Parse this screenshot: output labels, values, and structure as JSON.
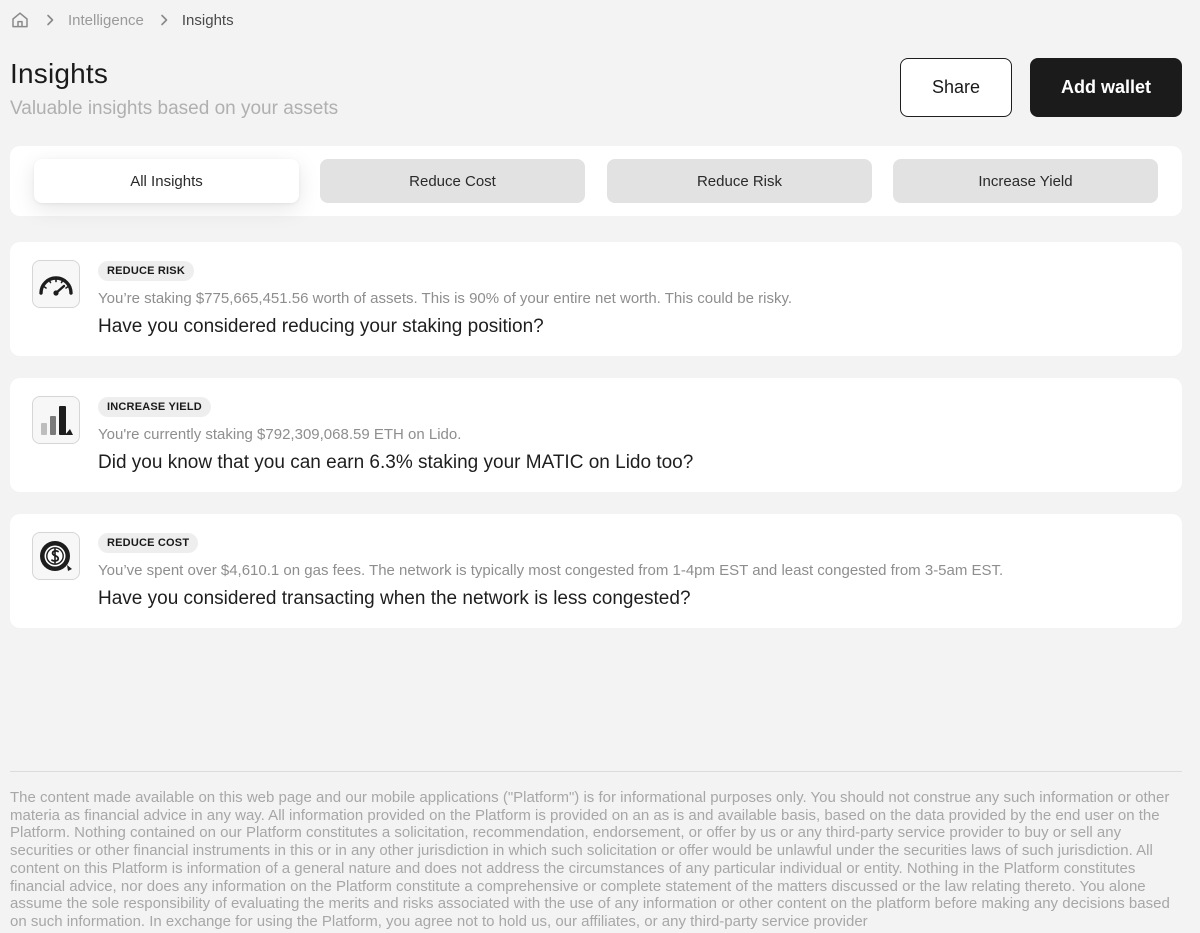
{
  "breadcrumb": {
    "home_icon": "home-icon",
    "items": [
      "Intelligence",
      "Insights"
    ]
  },
  "header": {
    "title": "Insights",
    "subtitle": "Valuable insights based on your assets",
    "share_label": "Share",
    "add_wallet_label": "Add wallet"
  },
  "tabs": [
    {
      "label": "All Insights",
      "active": true
    },
    {
      "label": "Reduce Cost",
      "active": false
    },
    {
      "label": "Reduce Risk",
      "active": false
    },
    {
      "label": "Increase Yield",
      "active": false
    }
  ],
  "insights": [
    {
      "icon": "speedometer-icon",
      "badge": "REDUCE RISK",
      "description": "You’re staking $775,665,451.56 worth of assets. This is 90% of your entire net worth. This could be risky.",
      "question": "Have you considered reducing your staking position?"
    },
    {
      "icon": "bar-chart-icon",
      "badge": "INCREASE YIELD",
      "description": "You're currently staking $792,309,068.59 ETH on Lido.",
      "question": "Did you know that you can earn 6.3% staking your MATIC on Lido too?"
    },
    {
      "icon": "gas-coin-icon",
      "badge": "REDUCE COST",
      "description": "You’ve spent over $4,610.1 on gas fees. The network is typically most congested from 1-4pm EST and least congested from 3-5am EST.",
      "question": "Have you considered transacting when the network is less congested?"
    }
  ],
  "disclaimer": "The content made available on this web page and our mobile applications (\"Platform\") is for informational purposes only. You should not construe any such information or other materia as financial advice in any way. All information provided on the Platform is provided on an as is and available basis, based on the data provided by the end user on the Platform. Nothing contained on our Platform constitutes a solicitation, recommendation, endorsement, or offer by us or any third-party service provider to buy or sell any securities or other financial instruments in this or in any other jurisdiction in which such solicitation or offer would be unlawful under the securities laws of such jurisdiction. All content on this Platform is information of a general nature and does not address the circumstances of any particular individual or entity. Nothing in the Platform constitutes financial advice, nor does any information on the Platform constitute a comprehensive or complete statement of the matters discussed or the law relating thereto. You alone assume the sole responsibility of evaluating the merits and risks associated with the use of any information or other content on the platform before making any decisions based on such information. In exchange for using the Platform, you agree not to hold us, our affiliates, or any third-party service provider"
}
